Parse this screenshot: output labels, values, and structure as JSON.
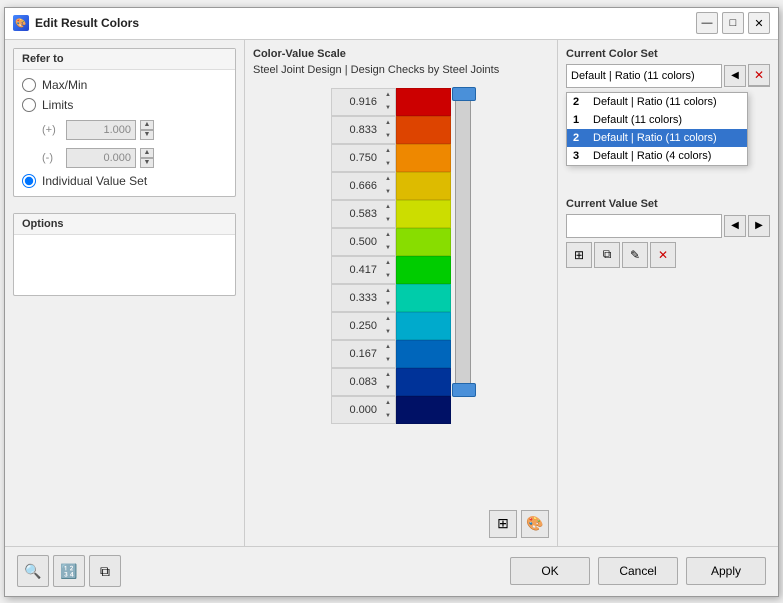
{
  "window": {
    "title": "Edit Result Colors",
    "icon": "🎨"
  },
  "left_panel": {
    "refer_to": {
      "title": "Refer to",
      "options": [
        {
          "id": "maxmin",
          "label": "Max/Min",
          "checked": false
        },
        {
          "id": "limits",
          "label": "Limits",
          "checked": false
        },
        {
          "id": "individual",
          "label": "Individual Value Set",
          "checked": true
        }
      ],
      "plus_value": "1.000",
      "minus_value": "0.000"
    },
    "options": {
      "title": "Options"
    }
  },
  "mid_panel": {
    "title": "Color-Value Scale",
    "description": "Steel Joint Design | Design Checks by Steel Joints",
    "scale_rows": [
      {
        "value": "0.916",
        "color": "#cc0000"
      },
      {
        "value": "0.833",
        "color": "#dd4400"
      },
      {
        "value": "0.750",
        "color": "#ee8800"
      },
      {
        "value": "0.666",
        "color": "#ddbb00"
      },
      {
        "value": "0.583",
        "color": "#ccdd00"
      },
      {
        "value": "0.500",
        "color": "#88dd00"
      },
      {
        "value": "0.417",
        "color": "#00cc00"
      },
      {
        "value": "0.333",
        "color": "#00ccaa"
      },
      {
        "value": "0.250",
        "color": "#00aacc"
      },
      {
        "value": "0.167",
        "color": "#0066bb"
      },
      {
        "value": "0.083",
        "color": "#003399"
      },
      {
        "value": "0.000",
        "color": "#001166"
      }
    ],
    "bottom_icons": [
      "⊞",
      "⊟"
    ]
  },
  "right_panel": {
    "current_color_set": {
      "title": "Current Color Set",
      "selected_value": "Default | Ratio (11 colors)",
      "dropdown_items": [
        {
          "num": "2",
          "label": "Default | Ratio (11 colors)",
          "selected": false
        },
        {
          "num": "1",
          "label": "Default (11 colors)",
          "selected": false
        },
        {
          "num": "2",
          "label": "Default | Ratio (11 colors)",
          "selected": true
        },
        {
          "num": "3",
          "label": "Default | Ratio (4 colors)",
          "selected": false
        }
      ]
    },
    "current_value_set": {
      "title": "Current Value Set"
    }
  },
  "footer": {
    "ok_label": "OK",
    "cancel_label": "Cancel",
    "apply_label": "Apply"
  }
}
